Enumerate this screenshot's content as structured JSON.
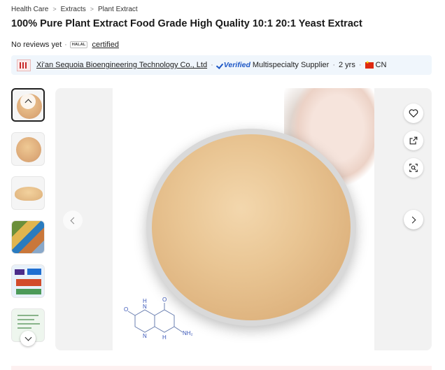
{
  "breadcrumb": {
    "items": [
      "Health Care",
      "Extracts",
      "Plant Extract"
    ],
    "separator": ">"
  },
  "product": {
    "title": "100% Pure Plant Extract Food Grade High Quality 10:1 20:1 Yeast Extract"
  },
  "reviews": {
    "text": "No reviews yet",
    "dot": "·",
    "badge": "HALAL",
    "certified": "certified"
  },
  "supplier": {
    "name": "Xi'an Sequoia Bioengineering Technology Co., Ltd",
    "verified": "Verified",
    "type": "Multispecialty Supplier",
    "years": "2 yrs",
    "country": "CN",
    "dot": "·"
  },
  "gallery": {
    "molecule_labels": {
      "o1": "O",
      "o2": "O",
      "n1": "N",
      "n2": "N",
      "h1": "H",
      "h2": "H",
      "nh2": "NH₂"
    }
  },
  "colors": {
    "accent": "#1d57c6",
    "powder": "#e9c593",
    "supplier_bg": "#f0f6fc"
  }
}
